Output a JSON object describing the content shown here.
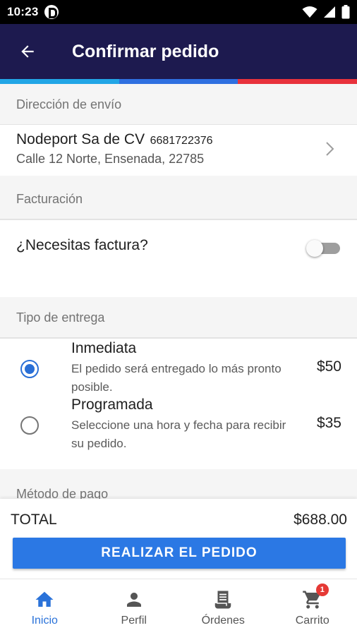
{
  "status_bar": {
    "time": "10:23"
  },
  "app_bar": {
    "title": "Confirmar pedido"
  },
  "accent_colors": [
    "#22a6e6",
    "#2f6fe0",
    "#e8323c"
  ],
  "shipping": {
    "header": "Dirección de envío",
    "name": "Nodeport Sa de CV",
    "phone": "6681722376",
    "address": "Calle 12 Norte, Ensenada, 22785"
  },
  "billing": {
    "header": "Facturación",
    "invoice_label": "¿Necesitas factura?",
    "invoice_enabled": false
  },
  "delivery": {
    "header": "Tipo de entrega",
    "options": [
      {
        "title": "Inmediata",
        "description": "El pedido será entregado lo más pronto posible.",
        "price": "$50",
        "selected": true
      },
      {
        "title": "Programada",
        "description": "Seleccione una hora y fecha para recibir su pedido.",
        "price": "$35",
        "selected": false
      }
    ]
  },
  "payment": {
    "header": "Método de pago"
  },
  "total": {
    "label": "TOTAL",
    "value": "$688.00"
  },
  "place_order_label": "REALIZAR EL PEDIDO",
  "bottom_nav": {
    "items": [
      {
        "label": "Inicio",
        "icon": "home-icon",
        "active": true
      },
      {
        "label": "Perfil",
        "icon": "person-icon",
        "active": false
      },
      {
        "label": "Órdenes",
        "icon": "receipt-icon",
        "active": false
      },
      {
        "label": "Carrito",
        "icon": "cart-icon",
        "active": false,
        "badge": "1"
      }
    ]
  }
}
